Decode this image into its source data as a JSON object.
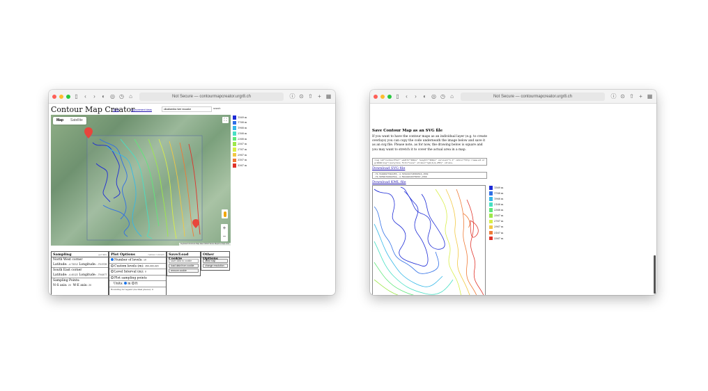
{
  "browser": {
    "url_text": "Not Secure — contourmapcreator.urgr8.ch"
  },
  "left": {
    "title": "Contour Map Creator",
    "links": [
      "ICON",
      "Improvement Ideas"
    ],
    "search_value": "cilcabamba river ecuador",
    "search_button": "search",
    "map_type": {
      "map": "Map",
      "satellite": "Satellite"
    },
    "map_footer": "Keyboard shortcuts  Map data ©2024  Terms  Report a map error",
    "sampling": {
      "header": "Sampling",
      "header_note": "get data",
      "nw_label": "North West corner",
      "nw_lat_label": "Latitude:",
      "nw_lat": "-4.73212",
      "nw_lon_label": "Longitude:",
      "nw_lon": "-79.3729",
      "se_label": "South East corner",
      "se_lat_label": "Latitude:",
      "se_lat": "-4.40122",
      "se_lon_label": "Longitude:",
      "se_lon": "-79.6477",
      "points_label": "Sampling Points:",
      "ns_label": "N-S axis:",
      "ns_val": "20",
      "we_label": "W-E axis:",
      "we_val": "20"
    },
    "plot": {
      "header": "Plot Options",
      "header_note": "redraw contours",
      "levels_label": "Number of levels:",
      "levels_val": "10",
      "custom_label": "Custom levels (m):",
      "custom_val": "350,400,420",
      "interval_label": "Level Interval (m):",
      "interval_val": "0",
      "plot_points": "Plot sampling points",
      "units_label": "Units:",
      "units_m": "m",
      "units_ft": "ft",
      "rounding": "Rounding for legend (decimal places):",
      "rounding_val": "0"
    },
    "cookie": {
      "header": "Save/Load Cookie",
      "cookie_input": "save data to cookie",
      "load_btn": "load data from cookie",
      "remove_btn": "remove cookie"
    },
    "other": {
      "header": "Other Options",
      "clear_btn": "clear map",
      "resolution_btn": "change resolution"
    }
  },
  "legend": [
    {
      "label": "1569 m",
      "color": "#1d2bd6"
    },
    {
      "label": "1768 m",
      "color": "#2f6fe6"
    },
    {
      "label": "1968 m",
      "color": "#35b8e8"
    },
    {
      "label": "2168 m",
      "color": "#48e0c4"
    },
    {
      "label": "2368 m",
      "color": "#5fe87a"
    },
    {
      "label": "2567 m",
      "color": "#9de84a"
    },
    {
      "label": "2767 m",
      "color": "#d8ee48"
    },
    {
      "label": "2967 m",
      "color": "#f2c842"
    },
    {
      "label": "3167 m",
      "color": "#ef7a36"
    },
    {
      "label": "3367 m",
      "color": "#e0332a"
    }
  ],
  "right": {
    "heading": "Save Contour Map as an SVG file",
    "paragraph": "If you want to have the contour maps as an individual layer (e.g. to create overlays) you can copy the code underneath the image below and save it as an svg file. Please note, as for now, the drawing below is square and you may want to stretch it to cover the actual area in a map.",
    "svg_code": "<svg id=\"contourPlot\" width=\"300px\" height=\"300px\" version=\"1.1\" xmlns=\"http://www.w3.org/2000/svg\"><polyline fill=\"none\" stroke=\"rgb(0,0,255)\" stroke-",
    "download_svg": "Download SVG file",
    "kml_code": "-79.51009977004455,-4.7858434746569516,1569\n-79.50598703402542,-4.598488346759567,1569",
    "download_kml": "Download KML file"
  }
}
